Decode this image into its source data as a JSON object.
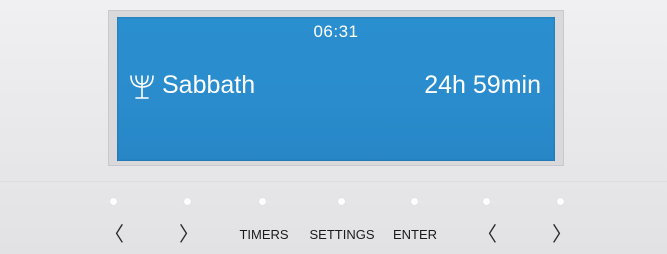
{
  "display": {
    "time": "06:31",
    "program": {
      "icon": "menorah-icon",
      "name": "Sabbath",
      "duration": "24h 59min"
    },
    "background_color": "#2a8ccd",
    "text_color": "#ffffff"
  },
  "controls": {
    "left_prev_label": "〈",
    "left_next_label": "〉",
    "timers_label": "TIMERS",
    "settings_label": "SETTINGS",
    "enter_label": "ENTER",
    "right_prev_label": "〈",
    "right_next_label": "〉"
  },
  "leds": [
    {
      "name": "led-1",
      "color": "#ffffff"
    },
    {
      "name": "led-2",
      "color": "#ffffff"
    },
    {
      "name": "led-3",
      "color": "#ffffff"
    },
    {
      "name": "led-4",
      "color": "#ffffff"
    },
    {
      "name": "led-5",
      "color": "#ffffff"
    },
    {
      "name": "led-6",
      "color": "#ffffff"
    },
    {
      "name": "led-7",
      "color": "#ffffff"
    }
  ]
}
